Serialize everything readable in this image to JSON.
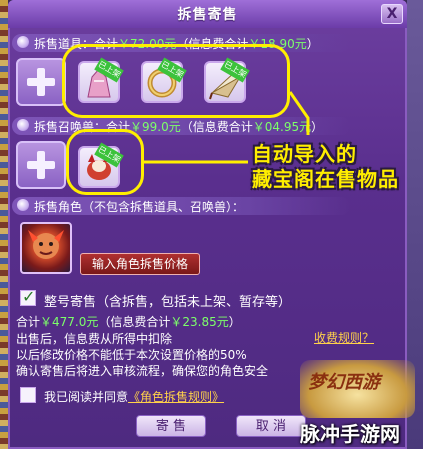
{
  "window": {
    "title": "拆售寄售",
    "close_label": "X"
  },
  "sections": {
    "items": {
      "label": "拆售道具：合计",
      "total": "￥72.00元",
      "fee_label": "（信息费合计",
      "fee": "￥18.90元",
      "fee_close": "）"
    },
    "pets": {
      "label": "拆售召唤兽：合计",
      "total": "￥99.0元",
      "fee_label": "（信息费合计",
      "fee": "￥04.95元",
      "fee_close": "）"
    },
    "character": {
      "label": "拆售角色（不包含拆售道具、召唤兽）："
    }
  },
  "item_slots": [
    {
      "name": "dress-item",
      "badge": "已上架"
    },
    {
      "name": "bracelet-item",
      "badge": "已上架"
    },
    {
      "name": "fan-item",
      "badge": "已上架"
    }
  ],
  "pet_slots": [
    {
      "name": "summoned-beast",
      "badge": "已上架"
    }
  ],
  "annotation": {
    "line1": "自动导入的",
    "line2": "藏宝阁在售物品"
  },
  "character": {
    "price_button": "输入角色拆售价格"
  },
  "whole_sale": {
    "checkbox_label": "整号寄售（含拆售，包括未上架、暂存等）",
    "checked": true,
    "total_label": "合计",
    "total": "￥477.0元",
    "fee_label": "（信息费合计",
    "fee": "￥23.85元",
    "fee_close": "）",
    "rules_link": "收费规则？",
    "notes": [
      "出售后，信息费从所得中扣除",
      "以后修改价格不能低于本次设置价格的50%",
      "确认寄售后将进入审核流程，确保您的角色安全"
    ]
  },
  "agreement": {
    "label": "我已阅读并同意",
    "link": "《角色拆售规则》",
    "checked": false
  },
  "buttons": {
    "sell": "寄 售",
    "cancel": "取 消"
  },
  "logo": {
    "text": "梦幻西游"
  },
  "watermark": "脉冲手游网",
  "colors": {
    "highlight": "#ffee00",
    "price_green": "#7dff6a",
    "panel": "#5a2f8e",
    "link": "#ffd24a"
  }
}
